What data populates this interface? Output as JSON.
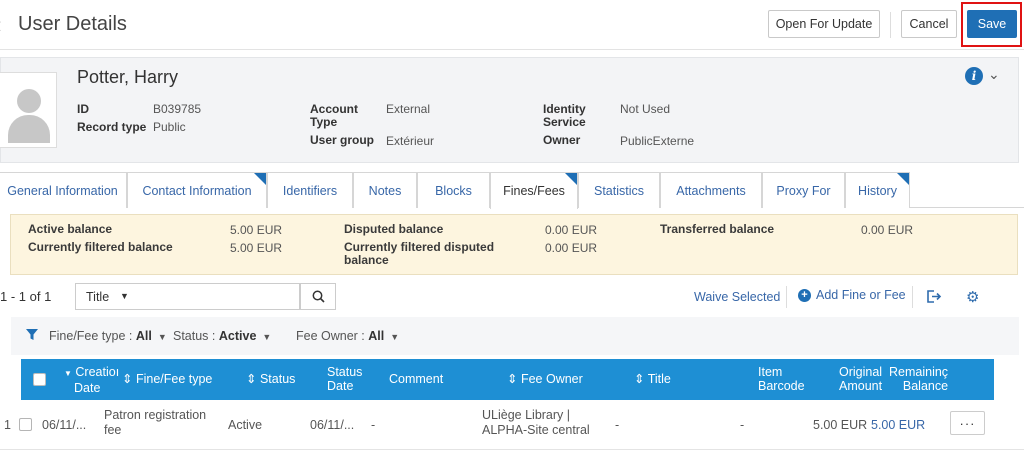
{
  "header": {
    "back_icon": "chevron-left-icon",
    "title": "User Details",
    "open_update_label": "Open For Update",
    "cancel_label": "Cancel",
    "save_label": "Save"
  },
  "user": {
    "name": "Potter, Harry",
    "id_label": "ID",
    "id_value": "B039785",
    "record_type_label": "Record type",
    "record_type_value": "Public",
    "account_type_label": "Account Type",
    "account_type_value": "External",
    "user_group_label": "User group",
    "user_group_value": "Extérieur",
    "identity_service_label": "Identity Service",
    "identity_service_value": "Not Used",
    "owner_label": "Owner",
    "owner_value": "PublicExterne"
  },
  "tabs": [
    {
      "label": "General Information",
      "active": false,
      "flag": false
    },
    {
      "label": "Contact Information",
      "active": false,
      "flag": true
    },
    {
      "label": "Identifiers",
      "active": false,
      "flag": false
    },
    {
      "label": "Notes",
      "active": false,
      "flag": false
    },
    {
      "label": "Blocks",
      "active": false,
      "flag": false
    },
    {
      "label": "Fines/Fees",
      "active": true,
      "flag": true
    },
    {
      "label": "Statistics",
      "active": false,
      "flag": false
    },
    {
      "label": "Attachments",
      "active": false,
      "flag": false
    },
    {
      "label": "Proxy For",
      "active": false,
      "flag": false
    },
    {
      "label": "History",
      "active": false,
      "flag": true
    }
  ],
  "balance": {
    "active_label": "Active balance",
    "active_value": "5.00 EUR",
    "filtered_label": "Currently filtered balance",
    "filtered_value": "5.00 EUR",
    "disputed_label": "Disputed balance",
    "disputed_value": "0.00 EUR",
    "filtered_disputed_label": "Currently filtered disputed balance",
    "filtered_disputed_value": "0.00 EUR",
    "transferred_label": "Transferred balance",
    "transferred_value": "0.00 EUR"
  },
  "toolbar": {
    "count": "1 - 1 of 1",
    "search_field": "Title",
    "search_value": "",
    "waive_label": "Waive Selected",
    "add_label": "Add Fine or Fee"
  },
  "filters": [
    {
      "label": "Fine/Fee type :",
      "value": "All"
    },
    {
      "label": "Status :",
      "value": "Active"
    },
    {
      "label": "Fee Owner :",
      "value": "All"
    }
  ],
  "table": {
    "headers": {
      "creation_date_1": "Creatioı",
      "creation_date_2": "Date",
      "type": "Fine/Fee type",
      "status": "Status",
      "status_date_1": "Status",
      "status_date_2": "Date",
      "comment": "Comment",
      "fee_owner": "Fee Owner",
      "title": "Title",
      "item_barcode_1": "Item",
      "item_barcode_2": "Barcode",
      "original_amount_1": "Original",
      "original_amount_2": "Amount",
      "remaining_balance_1": "Remaininç",
      "remaining_balance_2": "Balance"
    },
    "rows": [
      {
        "num": "1",
        "creation_date": "06/11/...",
        "type_1": "Patron registration",
        "type_2": "fee",
        "status": "Active",
        "status_date": "06/11/...",
        "comment": "-",
        "fee_owner_1": "ULiège Library |",
        "fee_owner_2": "ALPHA-Site central",
        "title": "-",
        "item_barcode": "-",
        "original_amount": "5.00 EUR",
        "remaining_balance": "5.00 EUR",
        "actions_label": "···"
      }
    ]
  },
  "colors": {
    "primary": "#1f6fb5",
    "table_header": "#1e8fd4",
    "balance_bg": "#fdf5df",
    "highlight": "#e01313"
  }
}
